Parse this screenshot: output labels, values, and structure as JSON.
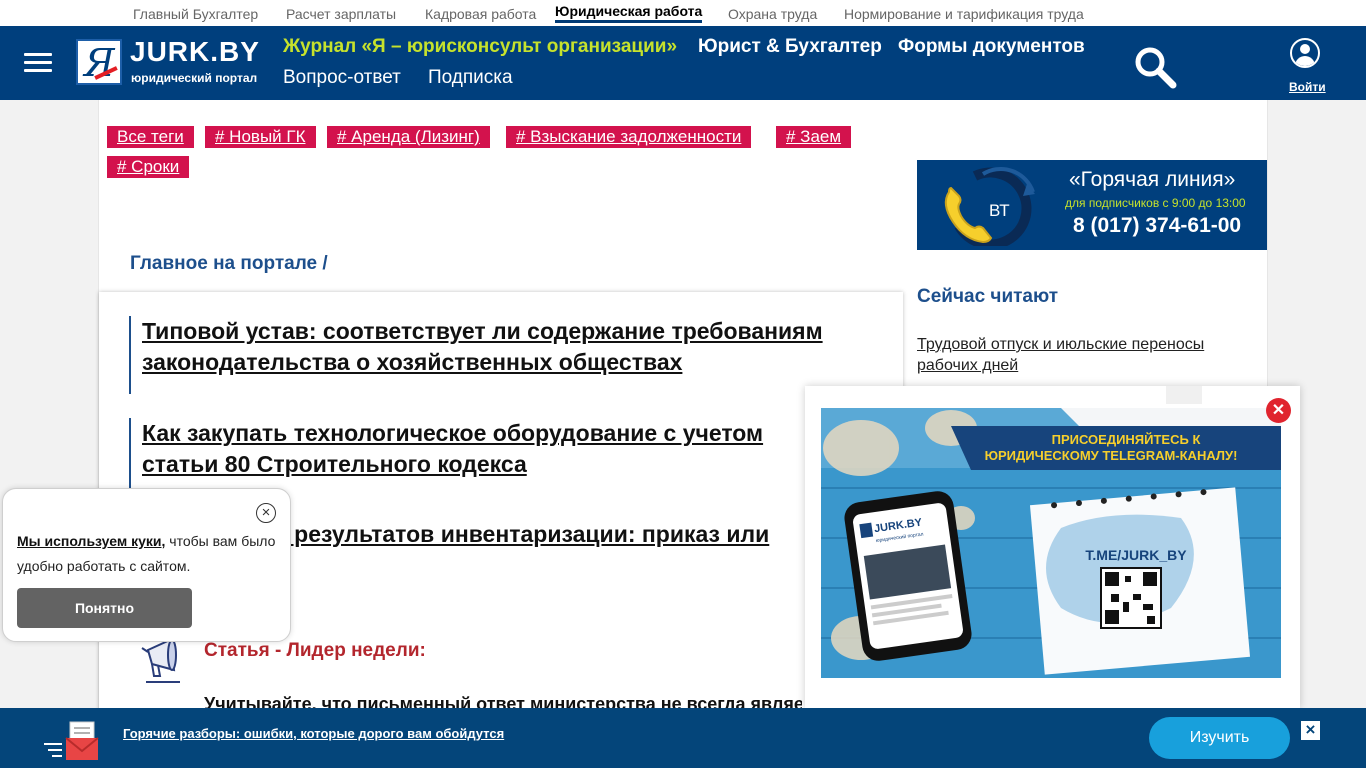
{
  "top_nav": {
    "items": [
      {
        "label": "Главный Бухгалтер"
      },
      {
        "label": "Расчет зарплаты"
      },
      {
        "label": "Кадровая работа"
      },
      {
        "label": "Юридическая работа",
        "active": true
      },
      {
        "label": "Охрана труда"
      },
      {
        "label": "Нормирование и тарификация труда"
      }
    ]
  },
  "header": {
    "logo_letter": "Я",
    "logo_name": "JURK.BY",
    "logo_tagline": "юридический портал",
    "nav": [
      {
        "label": "Журнал «Я – юрисконсульт организации»"
      },
      {
        "label": "Юрист & Бухгалтер"
      },
      {
        "label": "Формы документов"
      },
      {
        "label": "Вопрос-ответ"
      },
      {
        "label": "Подписка"
      }
    ],
    "login_label": "Войти",
    "accent_color": "#c6e22c",
    "bg_color": "#003f7d"
  },
  "tags": [
    {
      "label": "Все теги"
    },
    {
      "label": "# Новый ГК"
    },
    {
      "label": "# Аренда (Лизинг)"
    },
    {
      "label": "# Взыскание задолженности"
    },
    {
      "label": "# Заем"
    },
    {
      "label": "# Сроки"
    }
  ],
  "breadcrumb": "Главное на портале /",
  "news": [
    {
      "line1": "Типовой устав: соответствует ли содержание требованиям",
      "line2": "законодательства о хозяйственных обществах"
    },
    {
      "line1": "Как закупать технологическое оборудование с учетом",
      "line2": "статьи 80 Строительного кодекса"
    },
    {
      "line1": "е результатов инвентаризации: приказ или"
    }
  ],
  "leader": {
    "label": "Статья - Лидер недели:",
    "text": "Учитывайте, что письменный ответ министерства не всегда являе"
  },
  "hotline": {
    "title": "«Горячая линия»",
    "subtitle": "для подписчиков с 9:00 до 13:00",
    "day": "ВТ",
    "phone": "8 (017) 374-61-00"
  },
  "reading": {
    "title": "Сейчас читают",
    "items": [
      {
        "label": "Трудовой отпуск и июльские переносы рабочих дней"
      }
    ]
  },
  "popup": {
    "banner_headline_1": "ПРИСОЕДИНЯЙТЕСЬ К",
    "banner_headline_2": "ЮРИДИЧЕСКОМУ TELEGRAM-КАНАЛУ!",
    "banner_channel": "T.ME/JURK_BY",
    "phone_logo": "JURK.BY",
    "phone_tagline": "юридический портал"
  },
  "cookie": {
    "link_text": "Мы используем куки,",
    "text": " чтобы вам было удобно работать с сайтом.",
    "button_label": "Понятно"
  },
  "bottom_bar": {
    "link_text": "Горячие разборы: ошибки, которые дорого вам обойдутся",
    "button_label": "Изучить",
    "close_label": "×"
  }
}
